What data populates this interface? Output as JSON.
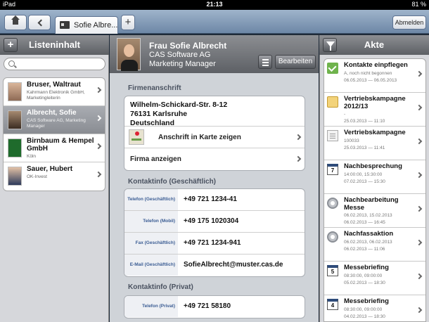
{
  "status": {
    "device": "iPad",
    "time": "21:13",
    "battery": "81 %"
  },
  "topbar": {
    "tab_label": "Sofie Albre...",
    "logout_label": "Abmelden"
  },
  "left": {
    "title": "Listeninhalt",
    "search_placeholder": "",
    "items": [
      {
        "name": "Bruser, Waltraut",
        "sub": "Kahrmann Elektronik GmbH, Marketingleiterin"
      },
      {
        "name": "Albrecht, Sofie",
        "sub": "CAS Software AG, Marketing Manager"
      },
      {
        "name": "Birnbaum & Hempel GmbH",
        "sub": "Köln"
      },
      {
        "name": "Sauer, Hubert",
        "sub": "OK-Invest"
      }
    ]
  },
  "contact": {
    "name": "Frau Sofie Albrecht",
    "company": "CAS Software AG",
    "role": "Marketing Manager",
    "edit_label": "Bearbeiten",
    "address_title": "Firmenanschrift",
    "address": [
      "Wilhelm-Schickard-Str. 8-12",
      "76131 Karlsruhe",
      "Deutschland"
    ],
    "map_label": "Anschrift in Karte zeigen",
    "company_label": "Firma anzeigen",
    "business_title": "Kontaktinfo (Geschäftlich)",
    "business": [
      {
        "label": "Telefon (Geschäftlich)",
        "value": "+49 721 1234-41"
      },
      {
        "label": "Telefon (Mobil)",
        "value": "+49 175 1020304"
      },
      {
        "label": "Fax (Geschäftlich)",
        "value": "+49 721 1234-941"
      },
      {
        "label": "E-Mail (Geschäftlich)",
        "value": "SofieAlbrecht@muster.cas.de"
      }
    ],
    "private_title": "Kontaktinfo (Privat)",
    "private": [
      {
        "label": "Telefon (Privat)",
        "value": "+49 721 58180"
      }
    ]
  },
  "right": {
    "title": "Akte",
    "items": [
      {
        "icon": "checkmark-icon",
        "title": "Kontakte einpflegen",
        "l1": "A, noch nicht begonnen",
        "l2": "06.05.2013 — 06.05.2013"
      },
      {
        "icon": "campaign-icon",
        "title": "Vertriebskampagne 2012/13",
        "l1": "-",
        "l2": "25.03.2013 — 11:10"
      },
      {
        "icon": "document-icon",
        "title": "Vertriebskampagne",
        "l1": "100033",
        "l2": "25.03.2013 — 11:41"
      },
      {
        "icon": "calendar-icon",
        "title": "Nachbesprechung",
        "l1": "14:00:00, 15:30:00",
        "l2": "07.02.2013 — 15:30"
      },
      {
        "icon": "gear-icon",
        "title": "Nachbearbeitung Messe",
        "l1": "06.02.2013, 15.02.2013",
        "l2": "06.02.2013 — 16:45"
      },
      {
        "icon": "gear-icon",
        "title": "Nachfassaktion",
        "l1": "06.02.2013, 06.02.2013",
        "l2": "06.02.2013 — 11:06"
      },
      {
        "icon": "calendar-icon",
        "title": "Messebriefing",
        "l1": "08:30:00, 09:00:00",
        "l2": "05.02.2013 — 18:30"
      },
      {
        "icon": "calendar-icon",
        "title": "Messebriefing",
        "l1": "08:30:00, 09:00:00",
        "l2": "04.02.2013 — 18:30"
      }
    ]
  }
}
